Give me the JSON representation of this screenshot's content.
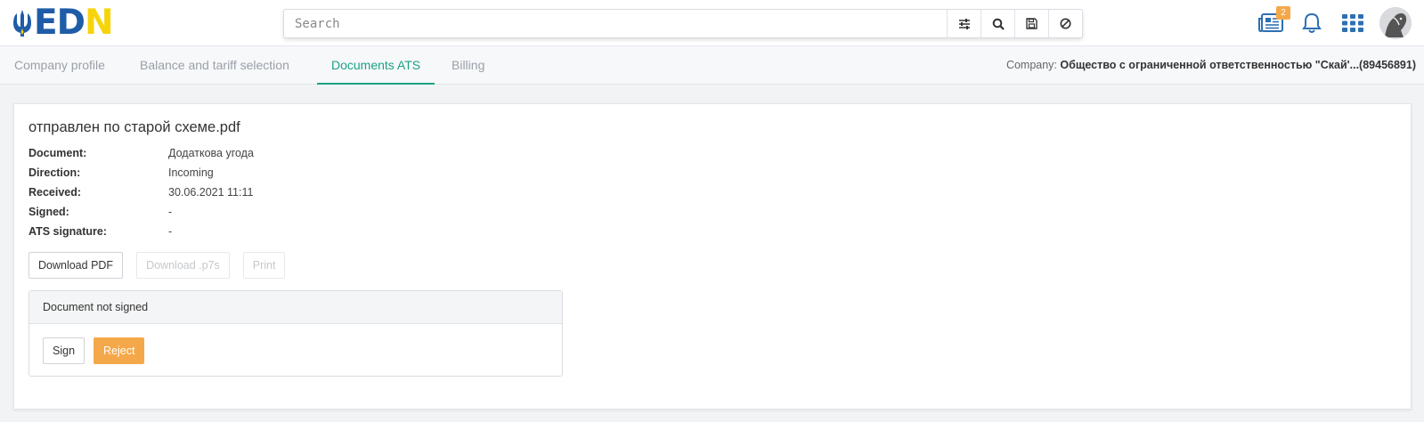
{
  "header": {
    "logo": {
      "part1": "ED",
      "part2": "N"
    },
    "search": {
      "placeholder": "Search"
    },
    "search_buttons": [
      "filter-icon",
      "search-icon",
      "save-icon",
      "clear-icon"
    ],
    "news_badge": "2",
    "icons": [
      "news-icon",
      "bell-icon",
      "apps-grid-icon",
      "avatar"
    ]
  },
  "tabs": [
    {
      "label": "Company profile",
      "active": false
    },
    {
      "label": "Balance and tariff selection",
      "active": false
    },
    {
      "label": "Documents ATS",
      "active": true
    },
    {
      "label": "Billing",
      "active": false
    }
  ],
  "company": {
    "label": "Company:",
    "name": "Общество с ограниченной ответственностью \"Скай'...(89456891)"
  },
  "document": {
    "title": "отправлен по старой схеме.pdf",
    "fields": [
      {
        "label": "Document:",
        "value": "Додаткова угода"
      },
      {
        "label": "Direction:",
        "value": "Incoming"
      },
      {
        "label": "Received:",
        "value": "30.06.2021 11:11"
      },
      {
        "label": "Signed:",
        "value": "-"
      },
      {
        "label": "ATS signature:",
        "value": "-"
      }
    ],
    "buttons": {
      "download_pdf": "Download PDF",
      "download_p7s": "Download .p7s",
      "print": "Print"
    }
  },
  "sign_panel": {
    "status": "Document not signed",
    "sign": "Sign",
    "reject": "Reject"
  },
  "colors": {
    "accent": "#1aa385",
    "orange": "#f5a84a",
    "brand_blue": "#1f5ca8",
    "brand_yellow": "#f7d40a"
  }
}
